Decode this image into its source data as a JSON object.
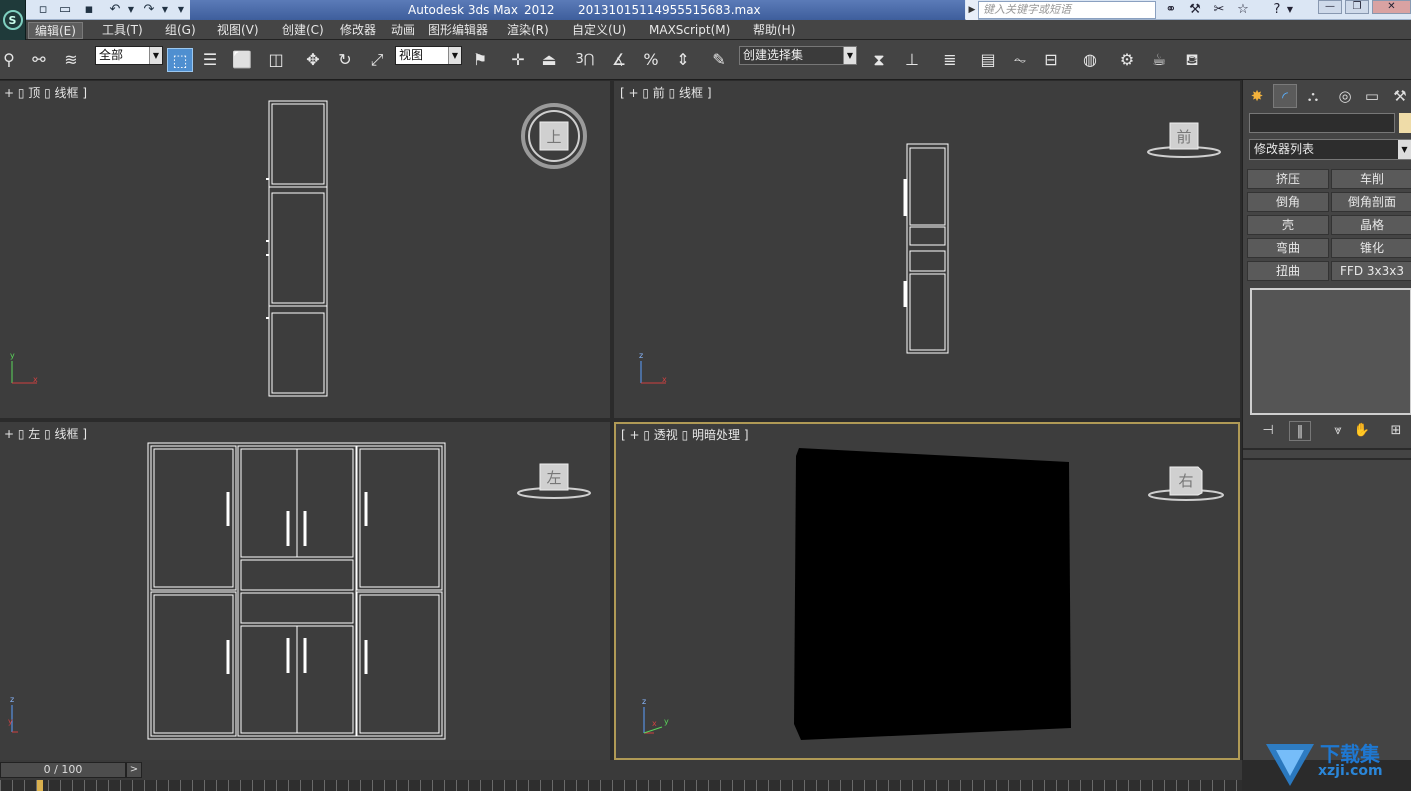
{
  "titlebar": {
    "app_name": "Autodesk 3ds Max",
    "version": "2012",
    "filename": "20131015114955515683.max",
    "search_placeholder": "键入关键字或短语"
  },
  "menu": {
    "items": [
      "编辑(E)",
      "工具(T)",
      "组(G)",
      "视图(V)",
      "创建(C)",
      "修改器",
      "动画",
      "图形编辑器",
      "渲染(R)",
      "自定义(U)",
      "MAXScript(M)",
      "帮助(H)"
    ]
  },
  "toolbar": {
    "selection_filter": "全部",
    "ref_coord": "视图",
    "snap_angle_label": "3",
    "named_selection": "创建选择集"
  },
  "viewports": {
    "top": {
      "label": "+ ▯ 顶 ▯ 线框 ]",
      "cube_face": "上",
      "axis_x": "x",
      "axis_y": "y"
    },
    "front": {
      "label": "[ + ▯ 前 ▯ 线框 ]",
      "cube_face": "前",
      "axis_x": "x",
      "axis_y": "z"
    },
    "left": {
      "label": "+ ▯ 左 ▯ 线框 ]",
      "cube_face": "左",
      "axis_x": "y",
      "axis_y": "z"
    },
    "perspective": {
      "label": "[ + ▯ 透视 ▯ 明暗处理 ]",
      "cube_face": "右",
      "axis_x": "x",
      "axis_y": "z",
      "axis_y2": "y"
    }
  },
  "command_panel": {
    "modifier_list": "修改器列表",
    "modifier_buttons": [
      "挤压",
      "车削",
      "倒角",
      "倒角剖面",
      "壳",
      "晶格",
      "弯曲",
      "锥化",
      "扭曲",
      "FFD 3x3x3"
    ]
  },
  "timeline": {
    "frame_display": "0 / 100",
    "next_label": ">"
  },
  "watermark": {
    "title": "下载集",
    "site": "xzji.com"
  },
  "colors": {
    "viewport_bg": "#3d3d3d",
    "active_viewport_border": "#b09a56",
    "accent": "#4f8fd0",
    "swatch": "#efdca8"
  }
}
